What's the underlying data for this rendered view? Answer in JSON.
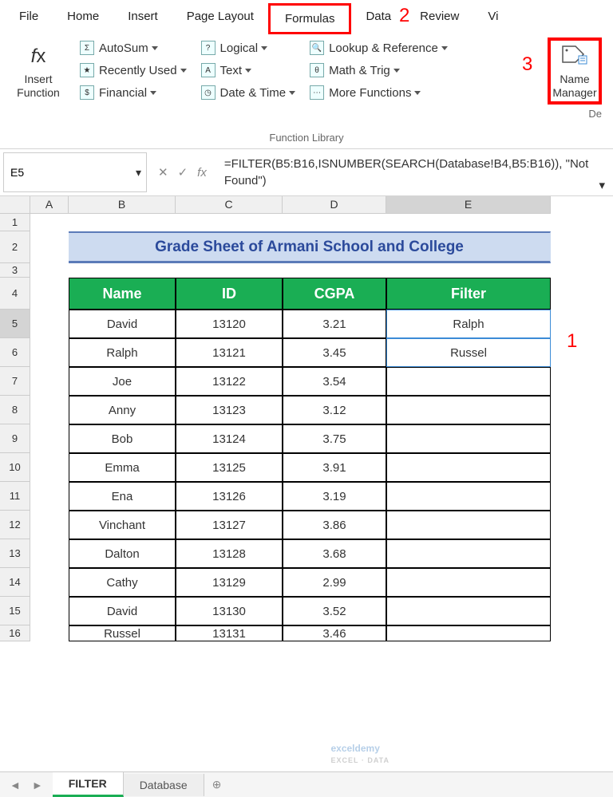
{
  "ribbon_tabs": [
    "File",
    "Home",
    "Insert",
    "Page Layout",
    "Formulas",
    "Data",
    "Review",
    "Vi"
  ],
  "active_tab": "Formulas",
  "ribbon": {
    "insert_function": "Insert\nFunction",
    "lib_group_label": "Function Library",
    "autosum": "AutoSum",
    "recent": "Recently Used",
    "financial": "Financial",
    "logical": "Logical",
    "text": "Text",
    "datetime": "Date & Time",
    "lookup": "Lookup & Reference",
    "math": "Math & Trig",
    "more": "More Functions",
    "name_manager": "Name\nManager",
    "de": "De"
  },
  "formula_bar": {
    "cell_ref": "E5",
    "formula": "=FILTER(B5:B16,ISNUMBER(SEARCH(Database!B4,B5:B16)), \"Not Found\")"
  },
  "columns": [
    "A",
    "B",
    "C",
    "D",
    "E"
  ],
  "selected_col": "E",
  "selected_row": 5,
  "worksheet": {
    "title": "Grade Sheet of Armani School and College",
    "headers": {
      "name": "Name",
      "id": "ID",
      "cgpa": "CGPA",
      "filter": "Filter"
    },
    "rows": [
      {
        "name": "David",
        "id": "13120",
        "cgpa": "3.21",
        "filter": "Ralph"
      },
      {
        "name": "Ralph",
        "id": "13121",
        "cgpa": "3.45",
        "filter": "Russel"
      },
      {
        "name": "Joe",
        "id": "13122",
        "cgpa": "3.54",
        "filter": ""
      },
      {
        "name": "Anny",
        "id": "13123",
        "cgpa": "3.12",
        "filter": ""
      },
      {
        "name": "Bob",
        "id": "13124",
        "cgpa": "3.75",
        "filter": ""
      },
      {
        "name": "Emma",
        "id": "13125",
        "cgpa": "3.91",
        "filter": ""
      },
      {
        "name": "Ena",
        "id": "13126",
        "cgpa": "3.19",
        "filter": ""
      },
      {
        "name": "Vinchant",
        "id": "13127",
        "cgpa": "3.86",
        "filter": ""
      },
      {
        "name": "Dalton",
        "id": "13128",
        "cgpa": "3.68",
        "filter": ""
      },
      {
        "name": "Cathy",
        "id": "13129",
        "cgpa": "2.99",
        "filter": ""
      },
      {
        "name": "David",
        "id": "13130",
        "cgpa": "3.52",
        "filter": ""
      },
      {
        "name": "Russel",
        "id": "13131",
        "cgpa": "3.46",
        "filter": ""
      }
    ]
  },
  "annotations": {
    "a1": "1",
    "a2": "2",
    "a3": "3"
  },
  "sheet_tabs": {
    "active": "FILTER",
    "other": "Database"
  },
  "watermark": {
    "brand": "exceldemy",
    "sub": "EXCEL · DATA"
  }
}
